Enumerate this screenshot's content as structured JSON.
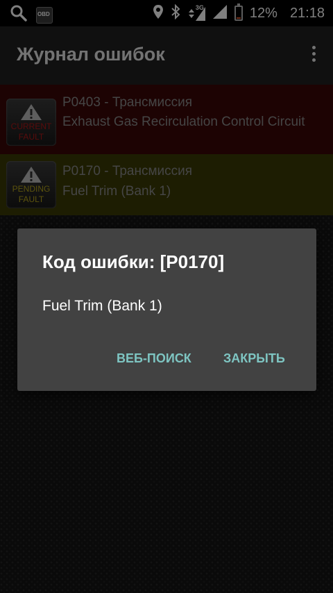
{
  "status_bar": {
    "network": "3G",
    "battery_percent_text": "12%",
    "battery_level": 0.12,
    "time": "21:18",
    "icons": [
      "search-icon",
      "obd-app-icon",
      "location-icon",
      "bluetooth-icon",
      "data-arrows-icon",
      "signal-icon",
      "signal-icon-2",
      "battery-icon"
    ]
  },
  "app_bar": {
    "title": "Журнал ошибок",
    "menu_icon": "overflow-menu-icon"
  },
  "faults": [
    {
      "code": "P0403 - Трансмиссия",
      "description": "Exhaust Gas Recirculation Control Circuit",
      "badge_line1": "CURRENT",
      "badge_line2": "FAULT",
      "row_color": "#3a0707",
      "badge_color": "#b11717"
    },
    {
      "code": "P0170 - Трансмиссия",
      "description": "Fuel Trim (Bank 1)",
      "badge_line1": "PENDING",
      "badge_line2": "FAULT",
      "row_color": "#3a3a05",
      "badge_color": "#b6a51a"
    }
  ],
  "dialog": {
    "title": "Код ошибки: [P0170]",
    "message": "Fuel Trim (Bank 1)",
    "buttons": {
      "web_search": "ВЕБ-ПОИСК",
      "close": "ЗАКРЫТЬ"
    },
    "accent_color": "#7ec5c2"
  }
}
